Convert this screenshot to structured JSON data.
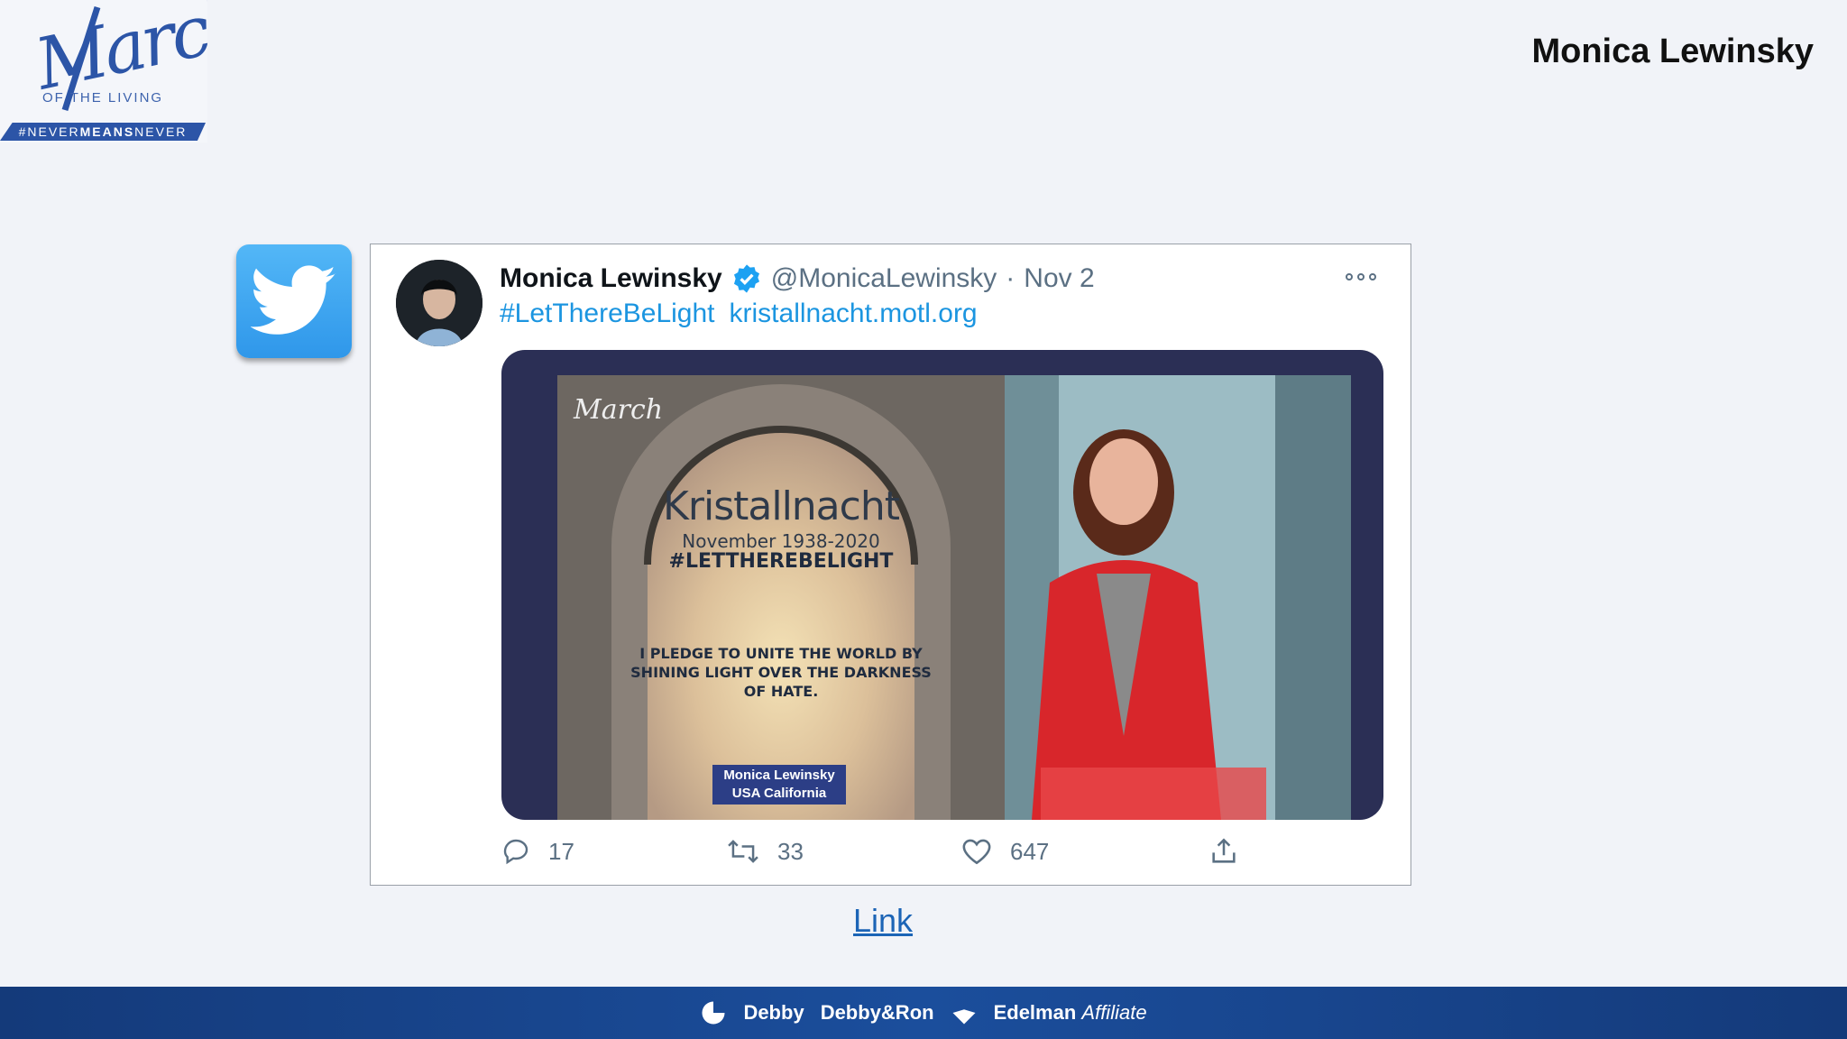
{
  "logo": {
    "script_text": "March",
    "subtitle": "OF THE LIVING",
    "ribbon_prefix": "#NEVER",
    "ribbon_bold": "MEANS",
    "ribbon_suffix": "NEVER"
  },
  "slide": {
    "title": "Monica Lewinsky"
  },
  "tweet": {
    "name": "Monica Lewinsky",
    "handle": "@MonicaLewinsky",
    "separator": "·",
    "date": "Nov 2",
    "hashtag": "#LetThereBeLight",
    "url": "kristallnacht.motl.org",
    "media": {
      "title": "Kristallnacht",
      "date_line": "November 1938-2020",
      "tag": "#LETTHEREBELIGHT",
      "pledge": "I PLEDGE TO UNITE THE WORLD BY SHINING LIGHT OVER THE DARKNESS OF HATE.",
      "name_line1": "Monica Lewinsky",
      "name_line2": "USA California"
    },
    "actions": {
      "replies": "17",
      "retweets": "33",
      "likes": "647"
    }
  },
  "link_text": "Link",
  "footer": {
    "brand1": "Debby",
    "brand2": "Debby&Ron",
    "brand3": "Edelman",
    "brand3_suffix": "Affiliate"
  },
  "colors": {
    "twitter_blue": "#1b95e0",
    "footer_blue": "#1b4e9c",
    "link_blue": "#1c64b6"
  }
}
